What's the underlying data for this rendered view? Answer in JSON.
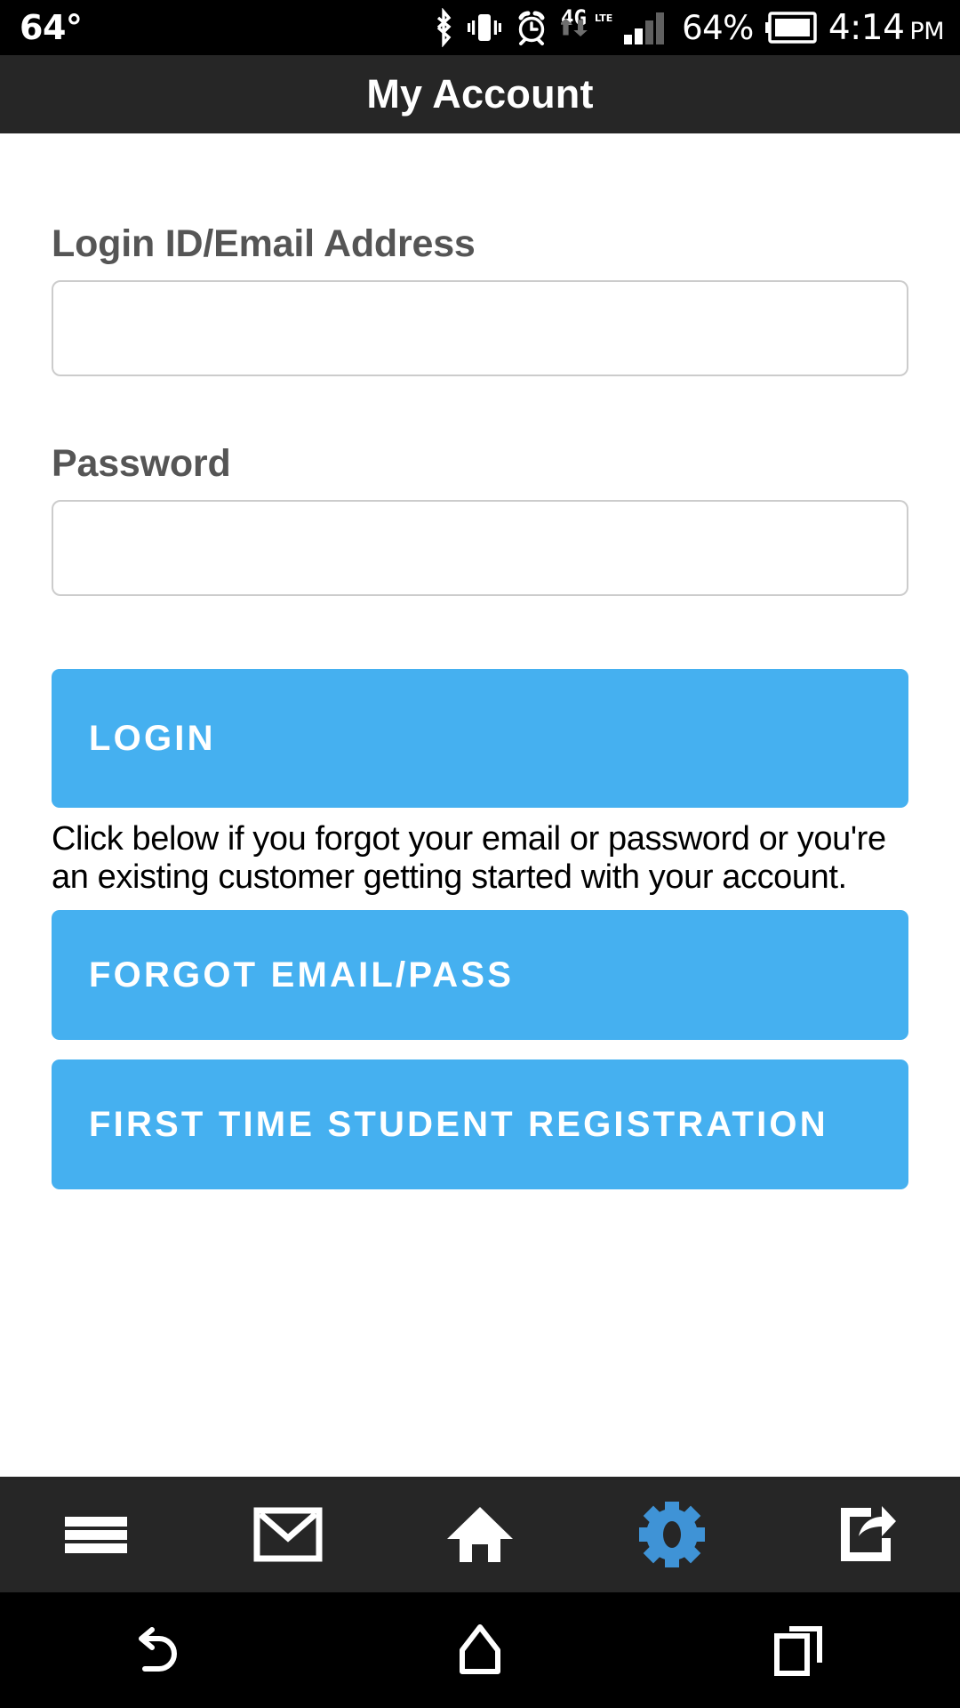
{
  "status_bar": {
    "temperature": "64°",
    "icons": [
      "bluetooth-icon",
      "vibrate-icon",
      "alarm-icon",
      "4g-lte-icon",
      "signal-bars-icon"
    ],
    "network_label": "4G",
    "network_sub_label": "LTE",
    "battery_percent": "64%",
    "battery_icon": "battery-icon",
    "time": "4:14",
    "time_period": "PM"
  },
  "header": {
    "title": "My Account"
  },
  "form": {
    "login_label": "Login ID/Email Address",
    "login_value": "",
    "login_placeholder": "",
    "password_label": "Password",
    "password_value": "",
    "password_placeholder": ""
  },
  "actions": {
    "login_label": "LOGIN",
    "helper_text": "Click below if you forgot your email or password or you're an existing customer getting started with your account.",
    "forgot_label": "FORGOT EMAIL/PASS",
    "register_label": "FIRST TIME STUDENT REGISTRATION"
  },
  "colors": {
    "accent": "#45b0f0",
    "header_bg": "#262626",
    "status_bg": "#000000",
    "label_text": "#555555",
    "input_border": "#cccccc"
  },
  "app_nav": {
    "items": [
      {
        "name": "menu-icon",
        "label": "Menu",
        "active": false
      },
      {
        "name": "mail-icon",
        "label": "Mail",
        "active": false
      },
      {
        "name": "home-icon",
        "label": "Home",
        "active": false
      },
      {
        "name": "gear-icon",
        "label": "Settings",
        "active": true
      },
      {
        "name": "share-icon",
        "label": "Share",
        "active": false
      }
    ]
  },
  "system_nav": {
    "items": [
      {
        "name": "back-icon",
        "label": "Back"
      },
      {
        "name": "home-icon",
        "label": "Home"
      },
      {
        "name": "recents-icon",
        "label": "Recent apps"
      }
    ]
  }
}
